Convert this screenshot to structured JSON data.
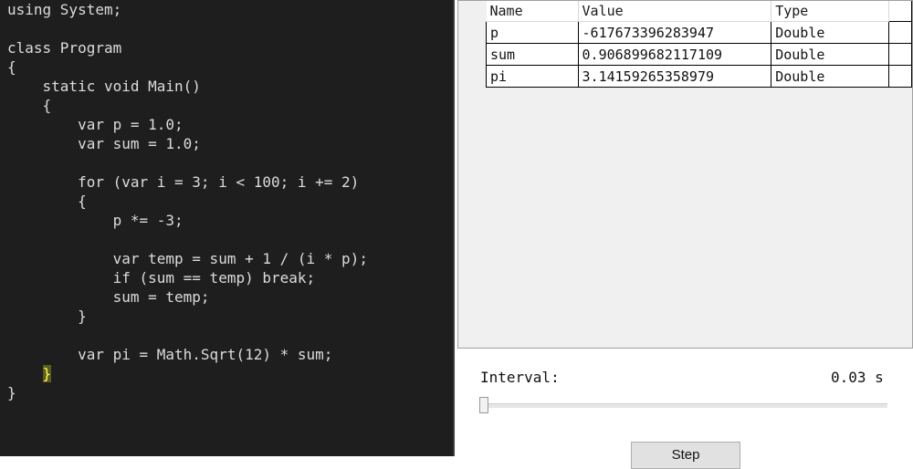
{
  "editor": {
    "lines": [
      "using System;",
      "",
      "class Program",
      "{",
      "    static void Main()",
      "    {",
      "        var p = 1.0;",
      "        var sum = 1.0;",
      "",
      "        for (var i = 3; i < 100; i += 2)",
      "        {",
      "            p *= -3;",
      "",
      "            var temp = sum + 1 / (i * p);",
      "            if (sum == temp) break;",
      "            sum = temp;",
      "        }",
      "",
      "        var pi = Math.Sqrt(12) * sum;",
      "    }",
      "}"
    ],
    "highlighted_brace": "}",
    "highlight_color": "#5c5c1f"
  },
  "variables": {
    "headers": [
      "Name",
      "Value",
      "Type"
    ],
    "rows": [
      {
        "name": "p",
        "value": "-617673396283947",
        "type": "Double"
      },
      {
        "name": "sum",
        "value": "0.906899682117109",
        "type": "Double"
      },
      {
        "name": "pi",
        "value": "3.14159265358979",
        "type": "Double"
      }
    ]
  },
  "controls": {
    "interval_label": "Interval:",
    "interval_value": "0.03 s",
    "slider_level": 0.0,
    "step_button_label": "Step"
  }
}
